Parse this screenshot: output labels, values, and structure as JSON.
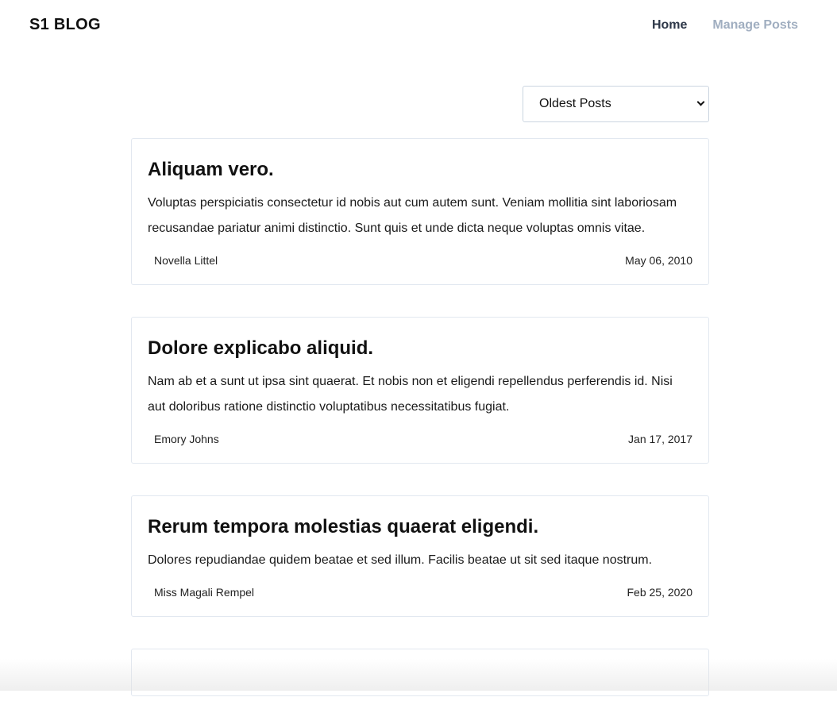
{
  "header": {
    "brand": "S1 BLOG",
    "nav": {
      "home": "Home",
      "manage_posts": "Manage Posts"
    }
  },
  "sort": {
    "selected": "Oldest Posts"
  },
  "posts": [
    {
      "title": "Aliquam vero.",
      "body": "Voluptas perspiciatis consectetur id nobis aut cum autem sunt. Veniam mollitia sint laboriosam recusandae pariatur animi distinctio. Sunt quis et unde dicta neque voluptas omnis vitae.",
      "author": "Novella Littel",
      "date": "May 06, 2010"
    },
    {
      "title": "Dolore explicabo aliquid.",
      "body": "Nam ab et a sunt ut ipsa sint quaerat. Et nobis non et eligendi repellendus perferendis id. Nisi aut doloribus ratione distinctio voluptatibus necessitatibus fugiat.",
      "author": "Emory Johns",
      "date": "Jan 17, 2017"
    },
    {
      "title": "Rerum tempora molestias quaerat eligendi.",
      "body": "Dolores repudiandae quidem beatae et sed illum. Facilis beatae ut sit sed itaque nostrum.",
      "author": "Miss Magali Rempel",
      "date": "Feb 25, 2020"
    }
  ],
  "colors": {
    "nav_active": "#2d3748",
    "nav_inactive": "#a0aec0",
    "card_border": "#e2e8f0"
  }
}
